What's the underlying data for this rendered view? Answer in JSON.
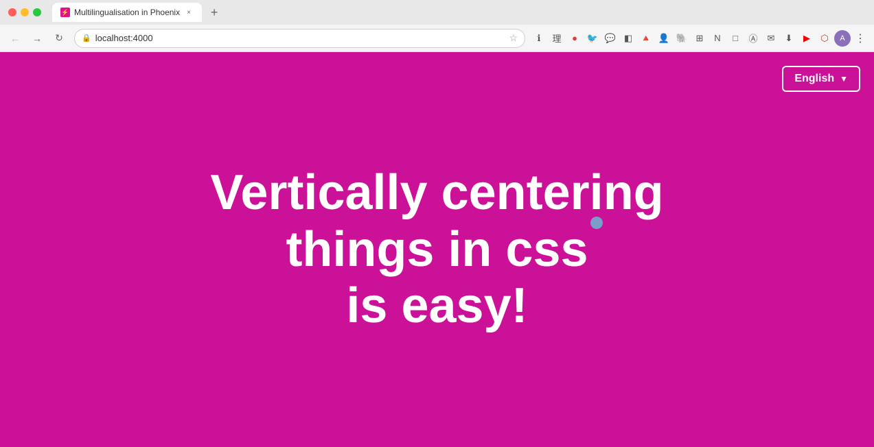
{
  "browser": {
    "tab": {
      "favicon_label": "⚡",
      "title": "Multilingualisation in Phoenix",
      "close_icon": "×"
    },
    "new_tab_icon": "+",
    "toolbar": {
      "back_icon": "←",
      "forward_icon": "→",
      "refresh_icon": "↻",
      "address": "localhost:4000",
      "star_icon": "☆",
      "menu_icon": "⋮"
    },
    "extension_icons": [
      "🔵",
      "理",
      "●",
      "🐦",
      "💬",
      "◧",
      "🔺",
      "👤",
      "🐘",
      "🔳",
      "N",
      "□",
      "Ⓐ",
      "✉",
      "⬇",
      "▶",
      "⬡"
    ]
  },
  "page": {
    "background_color": "#cc1199",
    "language_dropdown": {
      "label": "English",
      "arrow": "▼"
    },
    "hero_line1": "Vertically centering things in css",
    "hero_line2": "is easy!",
    "decorative_dot_color": "#7b9dc8"
  }
}
